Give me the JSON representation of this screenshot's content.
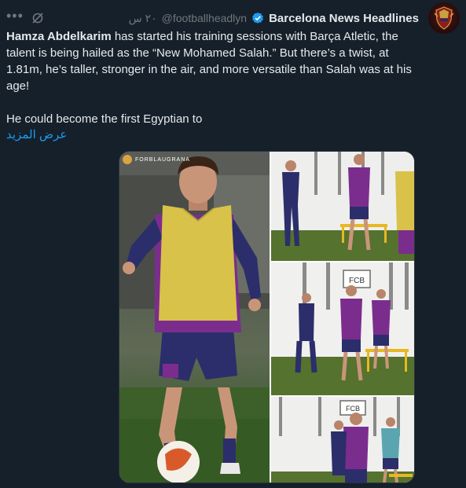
{
  "tweet": {
    "author_name": "Barcelona News Headlines",
    "handle": "@footballheadlyn",
    "time": "٢٠ س",
    "body_bold": "Hamza Abdelkarim",
    "body_rest": " has started his training sessions with Barça Atletic, the talent is being hailed as the “New Mohamed Salah.” But there’s a twist, at 1.81m, he’s taller, stronger in the air, and more versatile than Salah was at his age!",
    "body_line2": "He could become the first Egyptian to",
    "show_more": "عرض المزيد",
    "media_watermark": "FORBLAUGRANA"
  },
  "icons": {
    "more": "more-icon",
    "grok": "grok-icon",
    "verified": "verified-icon",
    "avatar": "avatar"
  },
  "colors": {
    "background": "#15202b",
    "text": "#e7e9ea",
    "muted": "#71767b",
    "link": "#1d9bf0",
    "verified": "#1d9bf0",
    "jersey_purple": "#7b2d8e",
    "bib_yellow": "#d8c24a"
  }
}
